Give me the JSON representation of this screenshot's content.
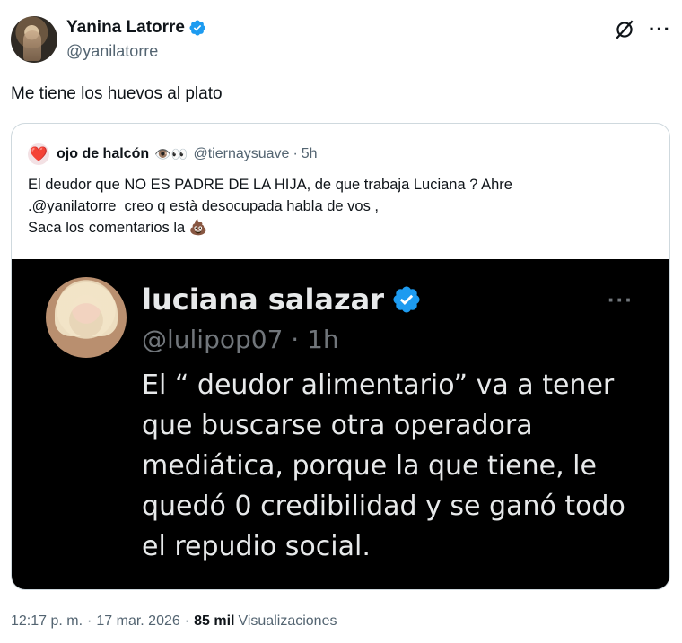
{
  "tweet": {
    "author_name": "Yanina Latorre",
    "author_handle": "@yanilatorre",
    "text": "Me tiene los huevos al plato",
    "time": "12:17 p. m.",
    "date": "17 mar. 2026",
    "views_count": "85 mil",
    "views_label": "Visualizaciones",
    "separator": "·"
  },
  "quote": {
    "avatar_emoji": "❤️",
    "name": "ojo de halcón",
    "name_emoji": "👁️👀",
    "handle": "@tiernaysuave",
    "separator": "·",
    "time": "5h",
    "lines": [
      "El deudor que NO ES PADRE DE LA HIJA, de que trabaja Luciana ? Ahre",
      ".@yanilatorre  creo q està desocupada habla de vos ,",
      "Saca los comentarios la 💩"
    ]
  },
  "screenshot": {
    "name": "luciana salazar",
    "handle": "@lulipop07",
    "separator": "·",
    "time": "1h",
    "lines": [
      "El “ deudor alimentario” va a tener",
      "que buscarse otra operadora",
      "mediática, porque la que tiene, le",
      "quedó 0 credibilidad y se ganó todo",
      "el repudio social."
    ]
  },
  "icons": {
    "verified": "verified-badge-icon",
    "grok": "grok-icon",
    "more": "more-options-icon"
  },
  "colors": {
    "verified_blue": "#1d9bf0",
    "text_primary": "#0f1419",
    "text_secondary": "#536471"
  }
}
